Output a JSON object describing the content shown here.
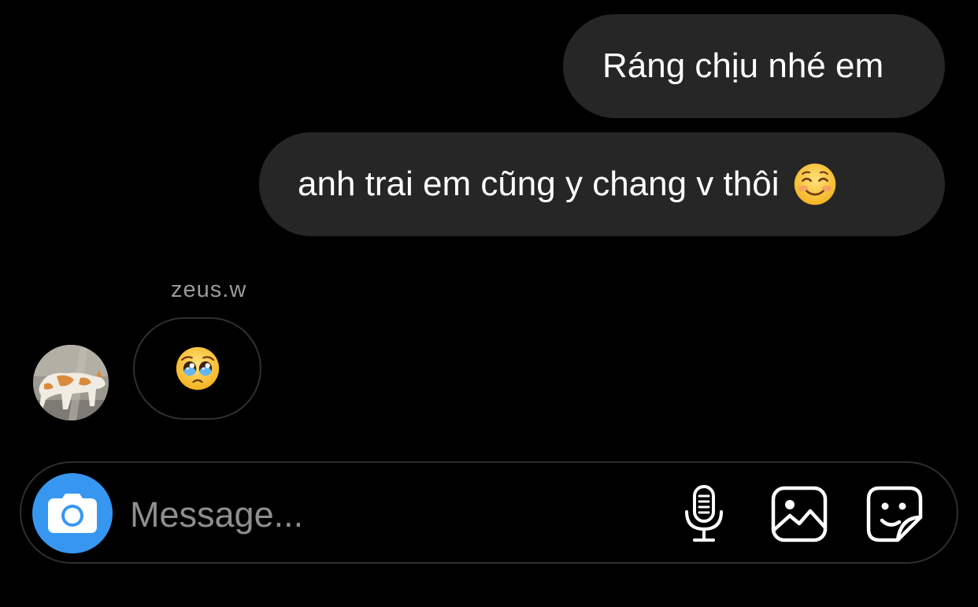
{
  "thread": {
    "outgoing": [
      {
        "text": "Ráng chịu nhé em"
      },
      {
        "text": "anh trai em cũng y chang v thôi",
        "emoji": "smiling-face-emoji"
      }
    ],
    "incoming": {
      "sender": "zeus.w",
      "avatar_icon": "cat-photo-avatar",
      "emoji": "pleading-face-emoji"
    }
  },
  "composer": {
    "placeholder": "Message...",
    "value": "",
    "icons": [
      "camera-icon",
      "microphone-icon",
      "gallery-icon",
      "sticker-icon"
    ]
  },
  "colors": {
    "background": "#000000",
    "outgoing_bubble": "#262626",
    "camera_button": "#3797f0",
    "placeholder": "#8e8e8e",
    "sender_name": "#9a9a9a"
  }
}
